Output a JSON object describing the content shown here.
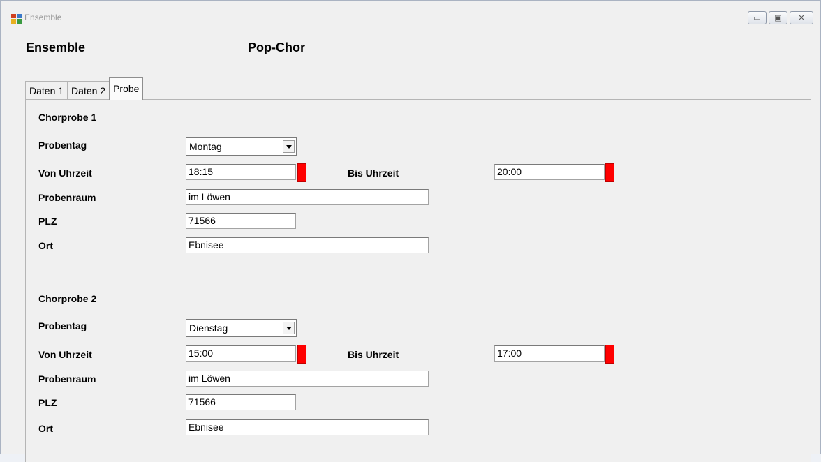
{
  "window": {
    "title": "Ensemble"
  },
  "header": {
    "label": "Ensemble",
    "value": "Pop-Chor"
  },
  "tabs": [
    {
      "label": "Daten 1"
    },
    {
      "label": "Daten 2"
    },
    {
      "label": "Probe"
    }
  ],
  "probe1": {
    "title": "Chorprobe 1",
    "probentag_label": "Probentag",
    "probentag_value": "Montag",
    "von_label": "Von Uhrzeit",
    "von_value": "18:15",
    "bis_label": "Bis Uhrzeit",
    "bis_value": "20:00",
    "raum_label": "Probenraum",
    "raum_value": "im Löwen",
    "plz_label": "PLZ",
    "plz_value": "71566",
    "ort_label": "Ort",
    "ort_value": "Ebnisee"
  },
  "probe2": {
    "title": "Chorprobe 2",
    "probentag_label": "Probentag",
    "probentag_value": "Dienstag",
    "von_label": "Von Uhrzeit",
    "von_value": "15:00",
    "bis_label": "Bis Uhrzeit",
    "bis_value": "17:00",
    "raum_label": "Probenraum",
    "raum_value": "im Löwen",
    "plz_label": "PLZ",
    "plz_value": "71566",
    "ort_label": "Ort",
    "ort_value": "Ebnisee"
  },
  "colors": {
    "marker": "#ff0000",
    "window_bg": "#f0f0f0"
  },
  "icons": {
    "app": "app-window-icon",
    "minimize": "minimize-icon",
    "maximize": "maximize-icon",
    "close": "close-icon"
  }
}
